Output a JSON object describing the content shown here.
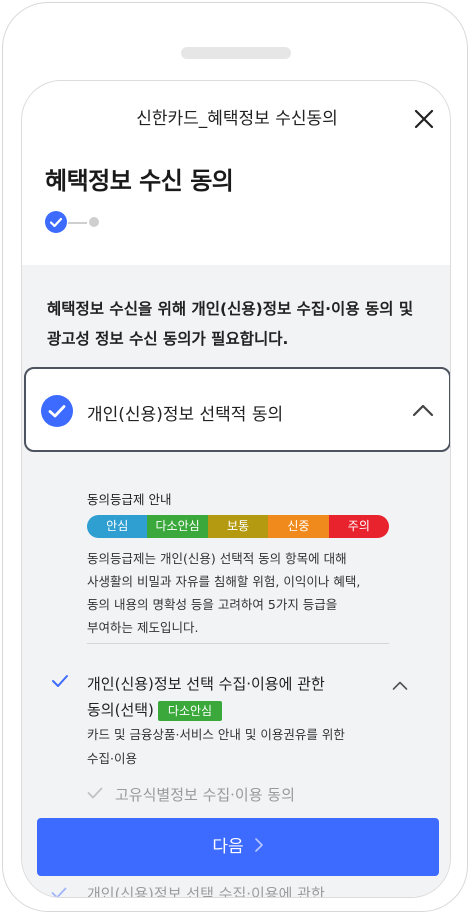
{
  "header": {
    "title": "신한카드_혜택정보 수신동의"
  },
  "page": {
    "title": "혜택정보 수신 동의"
  },
  "stepper": {
    "current": 1,
    "total": 2
  },
  "intro": {
    "line1": "혜택정보 수신을 위해 개인(신용)정보 수집·이용 동의 및",
    "line2": "광고성 정보 수신 동의가 필요합니다."
  },
  "consent_card": {
    "label": "개인(신용)정보 선택적 동의",
    "checked": true,
    "expanded": true
  },
  "grade_info": {
    "title": "동의등급제 안내",
    "grades": [
      {
        "label": "안심",
        "color": "#2e9fd0"
      },
      {
        "label": "다소안심",
        "color": "#3aa83a"
      },
      {
        "label": "보통",
        "color": "#b39a10"
      },
      {
        "label": "신중",
        "color": "#f08a1c"
      },
      {
        "label": "주의",
        "color": "#e8232e"
      }
    ],
    "description": {
      "line1": "동의등급제는 개인(신용) 선택적 동의 항목에 대해",
      "line2": "사생활의 비밀과 자유를 침해할 위험, 이익이나 혜택,",
      "line3": "동의 내용의 명확성 등을 고려하여 5가지 등급을",
      "line4": "부여하는 제도입니다."
    }
  },
  "item1": {
    "title_line1": "개인(신용)정보 선택 수집·이용에 관한",
    "title_line2": "동의(선택)",
    "tag": "다소안심",
    "desc_line1": "카드 및 금융상품·서비스 안내 및 이용권유를 위한",
    "desc_line2": "수집·이용"
  },
  "sub_item": {
    "label": "고유식별정보 수집·이용 동의"
  },
  "next_button": {
    "label": "다음"
  },
  "faded_item": {
    "label": "개인(신용)정보 선택 수집·이용에 관한"
  },
  "colors": {
    "primary": "#3d6bff",
    "tag_green": "#3aa83a"
  }
}
